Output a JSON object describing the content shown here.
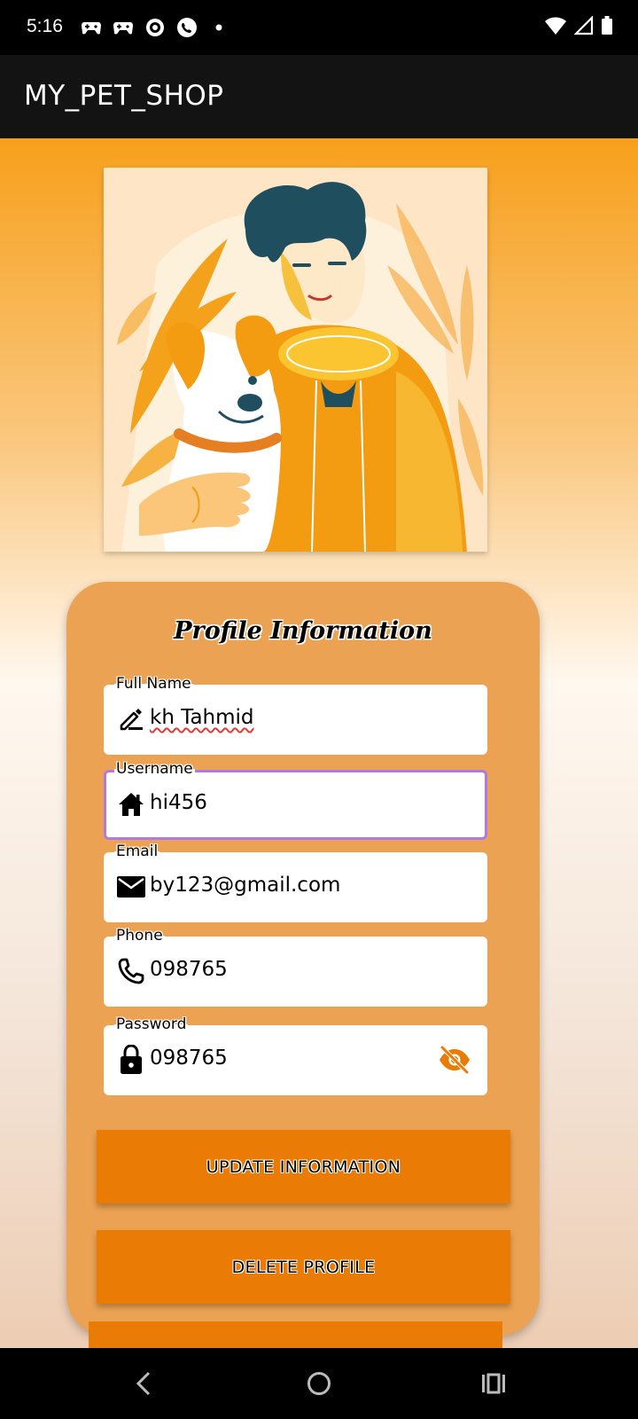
{
  "status_bar": {
    "time": "5:16"
  },
  "app_bar": {
    "title": "MY_PET_SHOP"
  },
  "profile_card": {
    "title": "Profile Information",
    "fields": [
      {
        "label": "Full Name",
        "value": "kh Tahmid",
        "icon": "edit-icon"
      },
      {
        "label": "Username",
        "value": "hi456",
        "icon": "home-icon"
      },
      {
        "label": "Email",
        "value": "by123@gmail.com",
        "icon": "mail-icon"
      },
      {
        "label": "Phone",
        "value": "098765",
        "icon": "phone-icon"
      },
      {
        "label": "Password",
        "value": "098765",
        "icon": "lock-icon"
      }
    ],
    "buttons": {
      "update": "UPDATE INFORMATION",
      "delete": "DELETE PROFILE"
    }
  },
  "colors": {
    "accent": "#ea7b04",
    "card": "#eba253",
    "focus": "#b07ae6",
    "app_bar": "#131313"
  }
}
